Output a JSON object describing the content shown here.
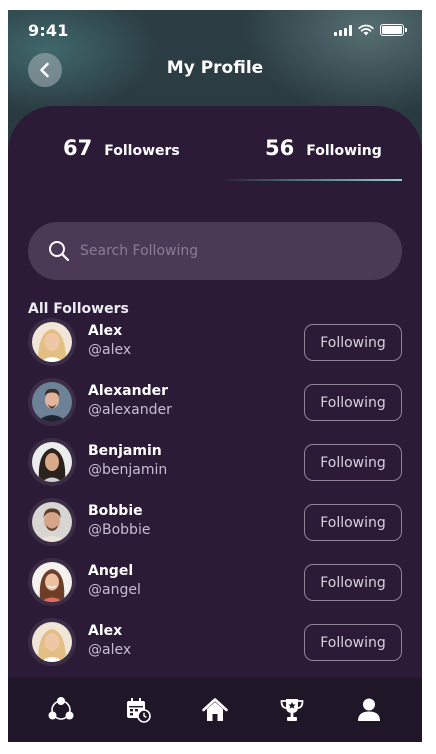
{
  "status_bar": {
    "time": "9:41"
  },
  "header": {
    "title": "My Profile"
  },
  "tabs": {
    "followers": {
      "count": "67",
      "label": "Followers"
    },
    "following": {
      "count": "56",
      "label": "Following"
    }
  },
  "search": {
    "placeholder": "Search Following",
    "value": ""
  },
  "section": {
    "title": "All Followers"
  },
  "users": [
    {
      "name": "Alex",
      "handle": "@alex",
      "button": "Following"
    },
    {
      "name": "Alexander",
      "handle": "@alexander",
      "button": "Following"
    },
    {
      "name": "Benjamin",
      "handle": "@benjamin",
      "button": "Following"
    },
    {
      "name": "Bobbie",
      "handle": "@Bobbie",
      "button": "Following"
    },
    {
      "name": "Angel",
      "handle": "@angel",
      "button": "Following"
    },
    {
      "name": "Alex",
      "handle": "@alex",
      "button": "Following"
    }
  ],
  "bottom_nav": [
    {
      "icon": "community-icon"
    },
    {
      "icon": "calendar-icon"
    },
    {
      "icon": "home-icon"
    },
    {
      "icon": "trophy-icon"
    },
    {
      "icon": "profile-icon",
      "active": true
    }
  ],
  "colors": {
    "panel_background": "#2b1b36",
    "search_background": "#4a3a55",
    "accent": "#8fd0c4",
    "nav_background": "#1f1628"
  }
}
